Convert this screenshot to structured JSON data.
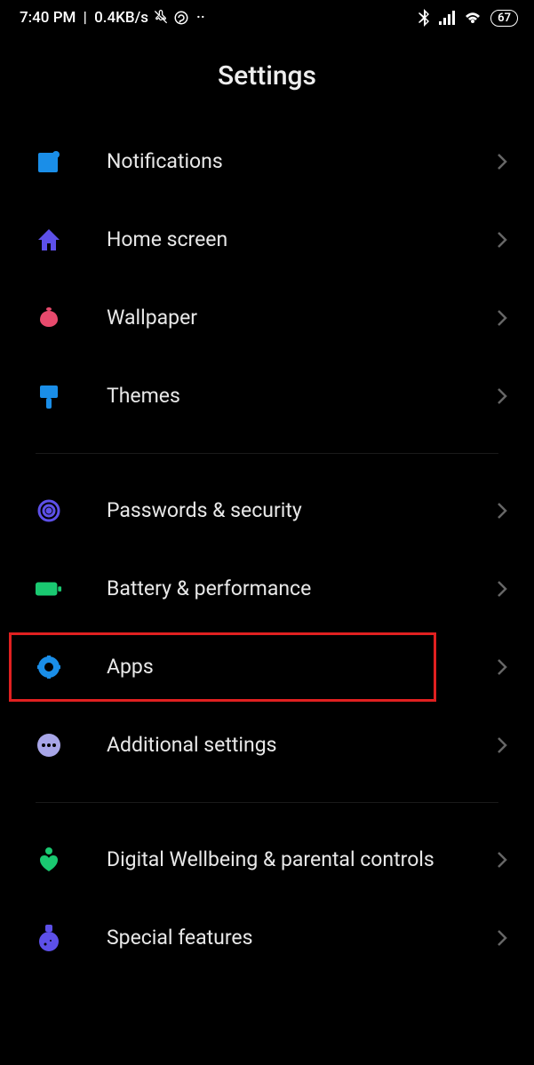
{
  "status_bar": {
    "time": "7:40 PM",
    "speed": "0.4KB/s",
    "battery": "67"
  },
  "page_title": "Settings",
  "sections": {
    "group1": [
      {
        "id": "notifications",
        "label": "Notifications",
        "icon": "notifications-icon",
        "color": "#1a8ee8"
      },
      {
        "id": "home-screen",
        "label": "Home screen",
        "icon": "home-icon",
        "color": "#5d50e8"
      },
      {
        "id": "wallpaper",
        "label": "Wallpaper",
        "icon": "wallpaper-icon",
        "color": "#e84a6d"
      },
      {
        "id": "themes",
        "label": "Themes",
        "icon": "themes-icon",
        "color": "#1a8ee8"
      }
    ],
    "group2": [
      {
        "id": "passwords-security",
        "label": "Passwords & security",
        "icon": "security-icon",
        "color": "#5d50e8"
      },
      {
        "id": "battery-performance",
        "label": "Battery & performance",
        "icon": "battery-icon",
        "color": "#1ac971"
      },
      {
        "id": "apps",
        "label": "Apps",
        "icon": "apps-icon",
        "color": "#1a8ee8",
        "highlighted": true
      },
      {
        "id": "additional-settings",
        "label": "Additional settings",
        "icon": "additional-icon",
        "color": "#a8a6e8"
      }
    ],
    "group3": [
      {
        "id": "digital-wellbeing",
        "label": "Digital Wellbeing & parental controls",
        "icon": "wellbeing-icon",
        "color": "#1ac971"
      },
      {
        "id": "special-features",
        "label": "Special features",
        "icon": "special-icon",
        "color": "#5d50e8"
      }
    ]
  }
}
